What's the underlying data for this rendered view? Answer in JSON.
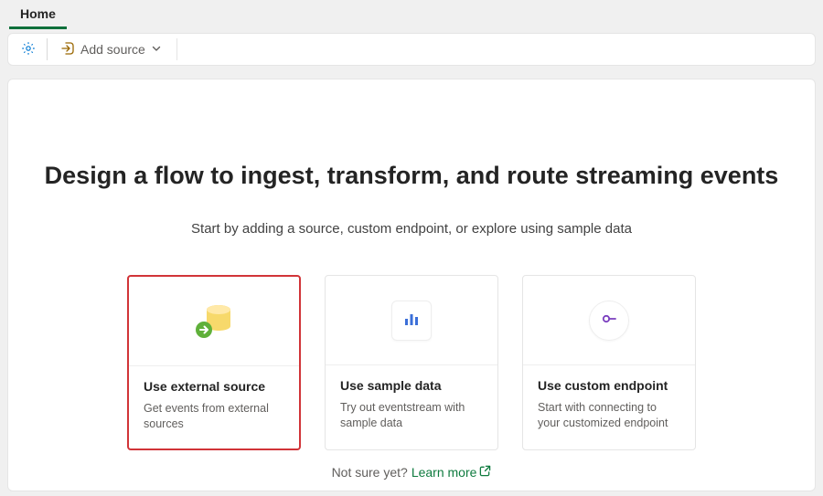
{
  "tabs": {
    "home": "Home"
  },
  "toolbar": {
    "add_source_label": "Add source"
  },
  "main": {
    "headline": "Design a flow to ingest, transform, and route streaming events",
    "subtitle": "Start by adding a source, custom endpoint, or explore using sample data"
  },
  "cards": [
    {
      "title": "Use external source",
      "desc": "Get events from external sources"
    },
    {
      "title": "Use sample data",
      "desc": "Try out eventstream with sample data"
    },
    {
      "title": "Use custom endpoint",
      "desc": "Start with connecting to your customized endpoint"
    }
  ],
  "footer": {
    "not_sure": "Not sure yet?",
    "learn_more": "Learn more"
  }
}
